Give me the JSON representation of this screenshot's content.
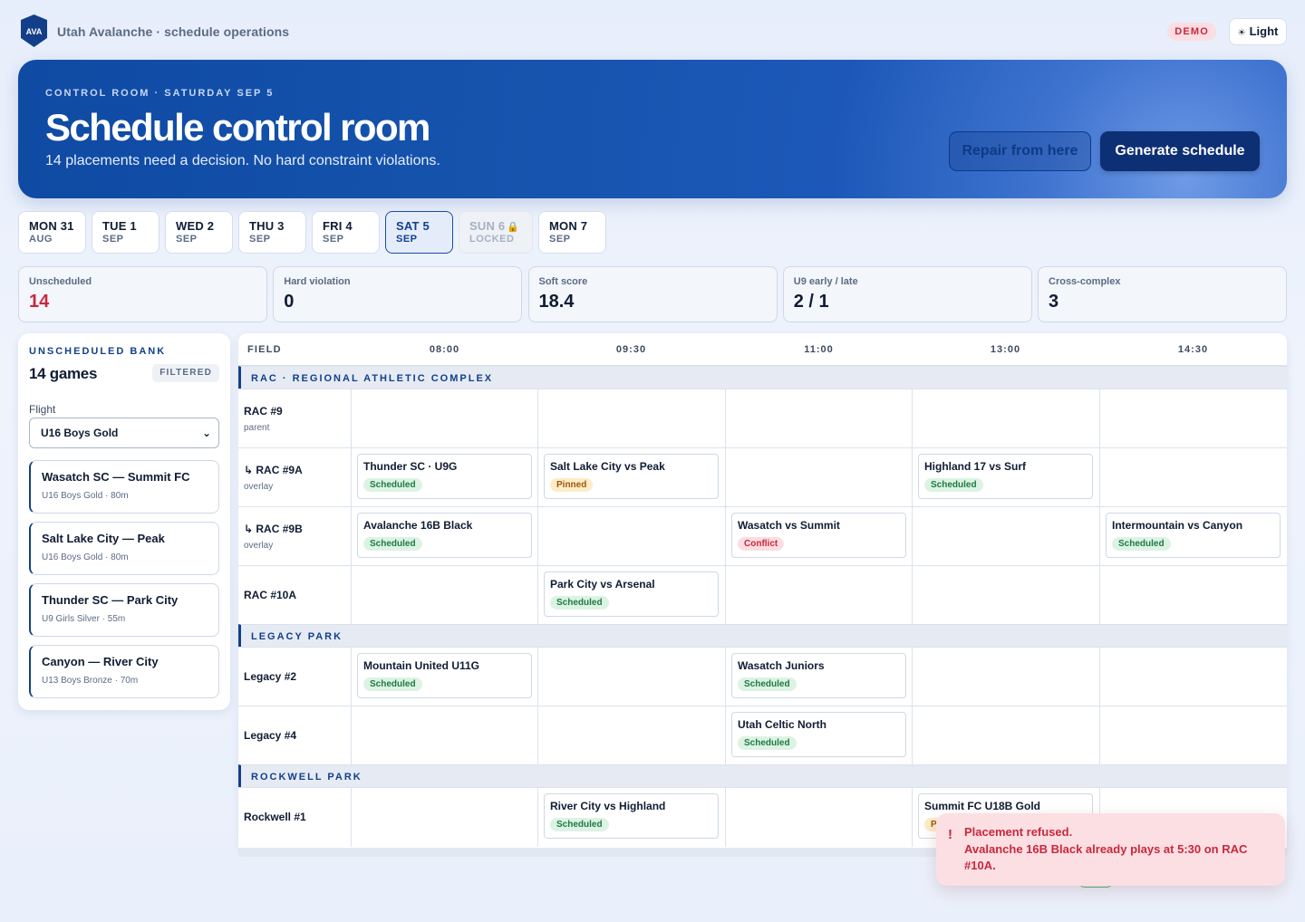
{
  "app": {
    "logo_text": "AVA",
    "title": "Utah Avalanche · schedule operations",
    "demo_badge": "DEMO",
    "theme_button": "Light",
    "theme_icon": "sun-icon"
  },
  "hero": {
    "eyebrow": "CONTROL ROOM · SATURDAY SEP 5",
    "title": "Schedule control room",
    "subtitle": "14 placements need a decision. No hard constraint violations.",
    "repair_label": "Repair from here",
    "generate_label": "Generate schedule"
  },
  "days": [
    {
      "day": "MON 31",
      "month": "AUG",
      "state": "normal"
    },
    {
      "day": "TUE 1",
      "month": "SEP",
      "state": "normal"
    },
    {
      "day": "WED 2",
      "month": "SEP",
      "state": "normal"
    },
    {
      "day": "THU 3",
      "month": "SEP",
      "state": "normal"
    },
    {
      "day": "FRI 4",
      "month": "SEP",
      "state": "normal"
    },
    {
      "day": "SAT 5",
      "month": "SEP",
      "state": "active"
    },
    {
      "day": "SUN 6",
      "month": "LOCKED",
      "state": "locked"
    },
    {
      "day": "MON 7",
      "month": "SEP",
      "state": "normal"
    }
  ],
  "stats": [
    {
      "label": "Unscheduled",
      "value": "14",
      "alert": true
    },
    {
      "label": "Hard violation",
      "value": "0",
      "alert": false
    },
    {
      "label": "Soft score",
      "value": "18.4",
      "alert": false
    },
    {
      "label": "U9 early / late",
      "value": "2 / 1",
      "alert": false
    },
    {
      "label": "Cross-complex",
      "value": "3",
      "alert": false
    }
  ],
  "bank": {
    "eyebrow": "UNSCHEDULED BANK",
    "count": "14 games",
    "filter_badge": "FILTERED",
    "flight_label": "Flight",
    "flight_value": "U16 Boys Gold",
    "cards": [
      {
        "title": "Wasatch SC — Summit FC",
        "meta": "U16 Boys Gold · 80m"
      },
      {
        "title": "Salt Lake City — Peak",
        "meta": "U16 Boys Gold · 80m"
      },
      {
        "title": "Thunder SC — Park City",
        "meta": "U9 Girls Silver · 55m"
      },
      {
        "title": "Canyon — River City",
        "meta": "U13 Boys Bronze · 70m"
      }
    ]
  },
  "grid": {
    "field_header": "FIELD",
    "times": [
      "08:00",
      "09:30",
      "11:00",
      "13:00",
      "14:30"
    ],
    "groups": [
      {
        "name": "RAC · REGIONAL ATHLETIC COMPLEX",
        "rows": [
          {
            "field": "RAC #9",
            "sub": "parent",
            "games": []
          },
          {
            "field": "↳ RAC #9A",
            "sub": "overlay",
            "games": [
              {
                "slot": 0,
                "title": "Thunder SC · U9G",
                "status": "Scheduled",
                "kind": "scheduled"
              },
              {
                "slot": 1,
                "title": "Salt Lake City vs Peak",
                "status": "Pinned",
                "kind": "pinned"
              },
              {
                "slot": 3,
                "title": "Highland 17 vs Surf",
                "status": "Scheduled",
                "kind": "scheduled"
              }
            ]
          },
          {
            "field": "↳ RAC #9B",
            "sub": "overlay",
            "games": [
              {
                "slot": 0,
                "title": "Avalanche 16B Black",
                "status": "Scheduled",
                "kind": "scheduled"
              },
              {
                "slot": 2,
                "title": "Wasatch vs Summit",
                "status": "Conflict",
                "kind": "conflict"
              },
              {
                "slot": 4,
                "title": "Intermountain vs Canyon",
                "status": "Scheduled",
                "kind": "scheduled"
              }
            ]
          },
          {
            "field": "RAC #10A",
            "sub": "",
            "games": [
              {
                "slot": 1,
                "title": "Park City vs Arsenal",
                "status": "Scheduled",
                "kind": "scheduled"
              }
            ]
          }
        ]
      },
      {
        "name": "LEGACY PARK",
        "rows": [
          {
            "field": "Legacy #2",
            "sub": "",
            "games": [
              {
                "slot": 0,
                "title": "Mountain United U11G",
                "status": "Scheduled",
                "kind": "scheduled"
              },
              {
                "slot": 2,
                "title": "Wasatch Juniors",
                "status": "Scheduled",
                "kind": "scheduled"
              }
            ]
          },
          {
            "field": "Legacy #4",
            "sub": "",
            "games": [
              {
                "slot": 2,
                "title": "Utah Celtic North",
                "status": "Scheduled",
                "kind": "scheduled"
              }
            ]
          }
        ]
      },
      {
        "name": "ROCKWELL PARK",
        "rows": [
          {
            "field": "Rockwell #1",
            "sub": "",
            "games": [
              {
                "slot": 1,
                "title": "River City vs Highland",
                "status": "Scheduled",
                "kind": "scheduled"
              },
              {
                "slot": 3,
                "title": "Summit FC U18B Gold",
                "status": "P",
                "kind": "pinned"
              }
            ]
          }
        ]
      }
    ]
  },
  "toast": {
    "icon": "!",
    "title": "Placement refused.",
    "message": "Avalanche 16B Black already plays at 5:30 on RAC #10A."
  },
  "colors": {
    "brand": "#133f8a",
    "hero": "#1553ad",
    "alert": "#c8283d",
    "scheduled": "#1e7a42",
    "pinned": "#9a5a06"
  }
}
